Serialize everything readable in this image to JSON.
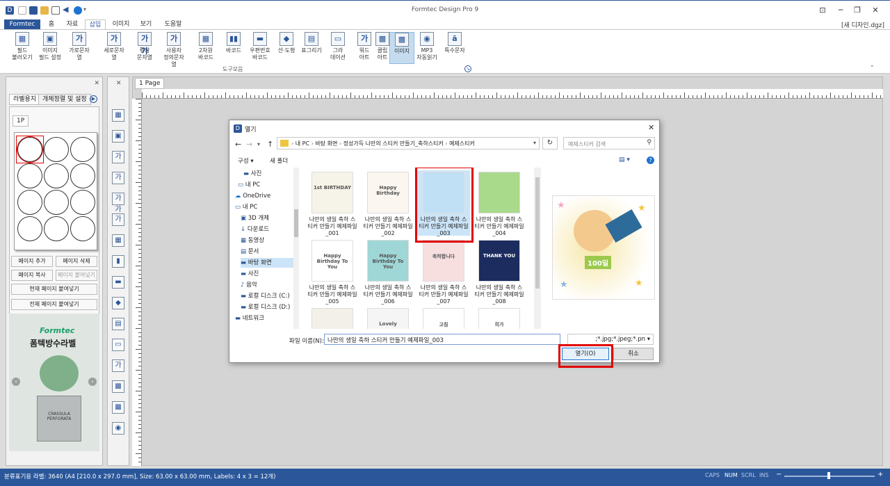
{
  "app": {
    "title": "Formtec Design Pro 9",
    "document": "[새 디자인.dgz]"
  },
  "menu": {
    "items": [
      "Formtec",
      "홈",
      "자료",
      "삽입",
      "이미지",
      "보기",
      "도움말"
    ]
  },
  "ribbon": {
    "buttons": [
      [
        "필드",
        "불러오기"
      ],
      [
        "이미지",
        "필드 설정"
      ],
      [
        "가로문자열",
        ""
      ],
      [
        "세로문자열",
        ""
      ],
      [
        "확장",
        "문자열"
      ],
      [
        "사용자",
        "정의문자열"
      ],
      [
        "2차원",
        "바코드"
      ],
      [
        "바코드",
        ""
      ],
      [
        "우편번호",
        "바코드"
      ],
      [
        "선·도형",
        ""
      ],
      [
        "표그리기",
        ""
      ],
      [
        "그라",
        "데이션"
      ],
      [
        "워드",
        "아트"
      ],
      [
        "클립",
        "아트"
      ],
      [
        "이미지",
        ""
      ],
      [
        "MP3",
        "자동읽기"
      ],
      [
        "특수문자",
        ""
      ]
    ],
    "icons": [
      "▦",
      "▣",
      "가",
      "가",
      "가가",
      "가",
      "▦",
      "▮▮",
      "▬",
      "◆",
      "▤",
      "▭",
      "가",
      "▩",
      "▩",
      "◉",
      "ā"
    ],
    "group_label": "도구모음"
  },
  "left_panel": {
    "tabs": [
      "라벨용지",
      "개체정렬 및 설정"
    ],
    "page_tab": "1P",
    "buttons": [
      "페이지 추가",
      "페이지 삭제",
      "페이지 복사",
      "페이지 붙여넣기",
      "현재 페이지 붙여넣기",
      "전체 페이지 붙여넣기"
    ],
    "ad_brand": "Formtec",
    "ad_title": "폼텍방수라벨",
    "ad_pot_text": "CRASSULA PERFORATA"
  },
  "canvas": {
    "page_tab": "1 Page"
  },
  "dialog": {
    "title": "열기",
    "breadcrumb": [
      "내 PC",
      "바탕 화면",
      "정성가득 나만의 스티커 만들기_축하스티커",
      "예제스티커"
    ],
    "search_placeholder": "예제스티커 검색",
    "toolbar": {
      "organize": "구성 ▾",
      "new_folder": "새 폴더"
    },
    "nav_items": [
      "사진",
      "내 PC",
      "OneDrive",
      "내 PC",
      "3D 개체",
      "다운로드",
      "동영상",
      "문서",
      "바탕 화면",
      "사진",
      "음악",
      "로컬 디스크 (C:)",
      "로컬 디스크 (D:)",
      "네트워크"
    ],
    "files": [
      {
        "name": "나만의 생일 축하 스티커 만들기 예제파일_001",
        "art": "1st BIRTHDAY"
      },
      {
        "name": "나만의 생일 축하 스티커 만들기 예제파일_002",
        "art": "Happy Birthday"
      },
      {
        "name": "나만의 생일 축하 스티커 만들기 예제파일_003",
        "art": ""
      },
      {
        "name": "나만의 생일 축하 스티커 만들기 예제파일_004",
        "art": ""
      },
      {
        "name": "나만의 생일 축하 스티커 만들기 예제파일_005",
        "art": "Happy Birthday To You"
      },
      {
        "name": "나만의 생일 축하 스티커 만들기 예제파일_006",
        "art": "Happy Birthday To You"
      },
      {
        "name": "나만의 생일 축하 스티커 만들기 예제파일_007",
        "art": "축하합니다"
      },
      {
        "name": "나만의 생일 축하 스티커 만들기 예제파일_008",
        "art": "THANK YOU"
      },
      {
        "name": "",
        "art": ""
      },
      {
        "name": "",
        "art": "Lovely"
      },
      {
        "name": "",
        "art": "고침"
      },
      {
        "name": "",
        "art": "히가"
      }
    ],
    "preview_text": "100일",
    "filename_label": "파일 이름(N):",
    "filename_value": "나만의 생일 축하 스티커 만들기 예제파일_003",
    "filter_value": ";*.jpg;*.jpeg;*.pn",
    "open_label": "열기(O)",
    "cancel_label": "취소"
  },
  "status": {
    "text": "분류표기용 라벨: 3640 (A4 [210.0 x 297.0 mm], Size: 63.00 x 63.00 mm, Labels: 4 x 3 = 12개)",
    "indicators": [
      "CAPS",
      "NUM",
      "SCRL",
      "INS"
    ]
  },
  "colors": {
    "accent": "#2b579a",
    "highlight": "#e00000"
  }
}
